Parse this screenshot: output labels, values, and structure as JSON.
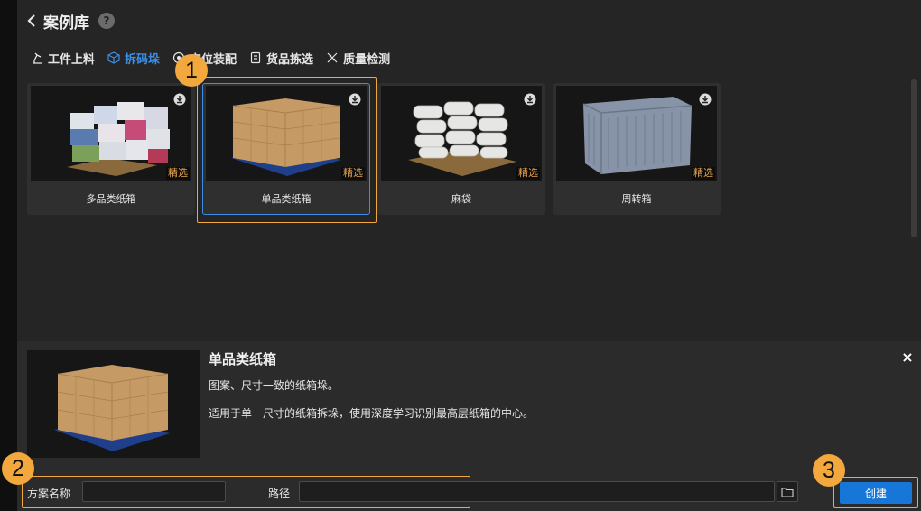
{
  "header": {
    "title": "案例库",
    "help": "?"
  },
  "tabs": [
    {
      "label": "工件上料",
      "icon": "robot-arm-icon",
      "active": false
    },
    {
      "label": "拆码垛",
      "icon": "box-3d-icon",
      "active": true
    },
    {
      "label": "定位装配",
      "icon": "target-icon",
      "active": false
    },
    {
      "label": "货品拣选",
      "icon": "package-icon",
      "active": false
    },
    {
      "label": "质量检测",
      "icon": "ruler-icon",
      "active": false
    }
  ],
  "cards": [
    {
      "label": "多品类纸箱",
      "badge": "精选",
      "icon": "download-icon"
    },
    {
      "label": "单品类纸箱",
      "badge": "精选",
      "icon": "download-icon",
      "selected": true
    },
    {
      "label": "麻袋",
      "badge": "精选",
      "icon": "download-icon"
    },
    {
      "label": "周转箱",
      "badge": "精选",
      "icon": "download-icon"
    }
  ],
  "markers": {
    "one": "1",
    "two": "2",
    "three": "3"
  },
  "detail": {
    "title": "单品类纸箱",
    "desc1": "图案、尺寸一致的纸箱垛。",
    "desc2": "适用于单一尺寸的纸箱拆垛，使用深度学习识别最高层纸箱的中心。",
    "close": "×"
  },
  "form": {
    "name_label": "方案名称",
    "name_value": "",
    "path_label": "路径",
    "path_value": "",
    "create_label": "创建"
  },
  "colors": {
    "accent": "#3d8fe6",
    "highlight": "#f2a83c",
    "badge": "#e6a14a",
    "button": "#1677d9"
  }
}
